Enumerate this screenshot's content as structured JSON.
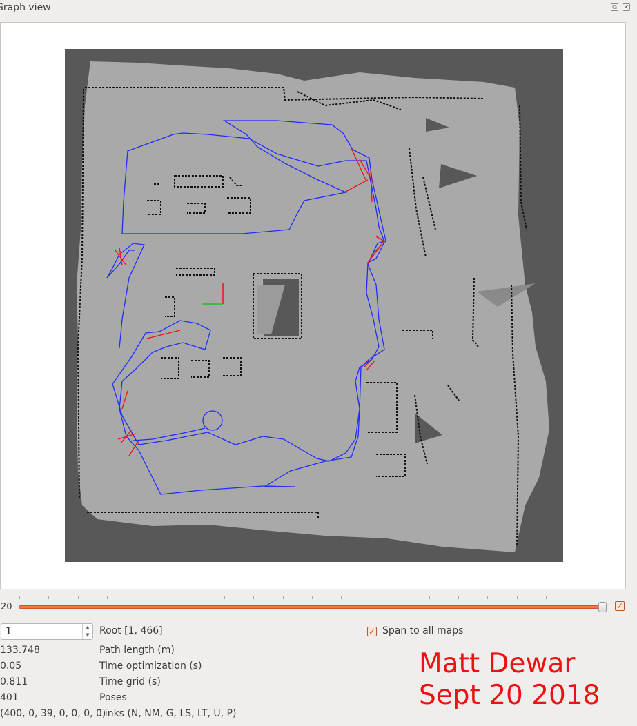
{
  "window": {
    "title": "Graph view",
    "buttons": [
      "restore",
      "close"
    ]
  },
  "slider": {
    "min_label": "20",
    "value_fraction": 1.0,
    "enabled_checkbox": true
  },
  "root": {
    "spin_value": "1",
    "label": "Root [1, 466]"
  },
  "span_to_all_maps": {
    "checked": true,
    "label": "Span to all maps"
  },
  "stats": [
    {
      "value": "133.748",
      "label": "Path length (m)"
    },
    {
      "value": "0.05",
      "label": "Time optimization (s)"
    },
    {
      "value": "0.811",
      "label": "Time grid (s)"
    },
    {
      "value": "401",
      "label": "Poses"
    },
    {
      "value": "(400, 0, 39, 0, 0, 0, 0)",
      "label": "Links (N, NM, G, LS, LT, U, P)"
    }
  ],
  "watermark": {
    "line1": "Matt Dewar",
    "line2": "Sept 20 2018"
  },
  "colors": {
    "map_unknown": "#585858",
    "map_free": "#a9a9a9",
    "obstacle": "#111111",
    "path": "#1f2cff",
    "loop_links": "#ee1111",
    "slider_accent": "#f07746",
    "watermark": "#ee1111"
  },
  "icons": {
    "restore": "restore-window-icon",
    "close": "close-window-icon",
    "check": "check-icon",
    "spin_up": "arrow-up-icon",
    "spin_down": "arrow-down-icon"
  }
}
